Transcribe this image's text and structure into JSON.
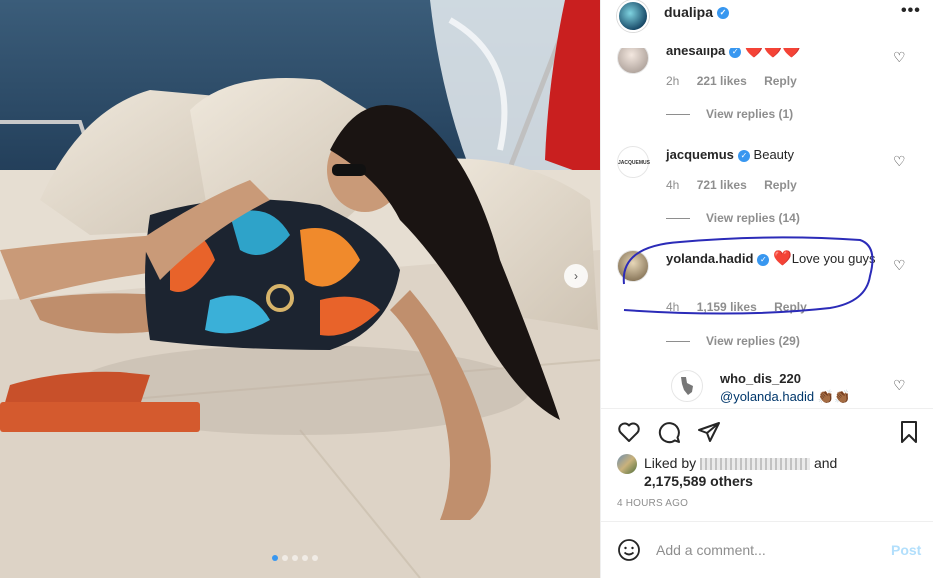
{
  "post": {
    "username": "dualipa",
    "more_icon": "•••",
    "photo_dots": 5,
    "active_dot": 0,
    "next_arrow": "›"
  },
  "comments": [
    {
      "username": "anesalipa",
      "text": "",
      "emoji": "❤️❤️❤️",
      "time": "2h",
      "likes": "221 likes",
      "reply": "Reply",
      "view_replies": "View replies (1)"
    },
    {
      "username": "jacquemus",
      "avatar_text": "JACQUEMUS",
      "text": "Beauty",
      "time": "4h",
      "likes": "721 likes",
      "reply": "Reply",
      "view_replies": "View replies (14)"
    },
    {
      "username": "yolanda.hadid",
      "text": "Love you guys",
      "emoji": "❤️",
      "time": "4h",
      "likes": "1,159 likes",
      "reply": "Reply",
      "view_replies": "View replies (29)"
    },
    {
      "username": "who_dis_220",
      "text": "@yolanda.hadid",
      "emoji": "👏🏾👏🏾"
    }
  ],
  "likes": {
    "prefix": "Liked by",
    "suffix": "and",
    "count": "2,175,589 others"
  },
  "timestamp": "4 HOURS AGO",
  "add_comment": {
    "placeholder": "Add a comment...",
    "post_label": "Post"
  },
  "colors": {
    "verified": "#3897f0",
    "annotation": "#2b2bb8",
    "post_disabled": "#b2dffc"
  }
}
